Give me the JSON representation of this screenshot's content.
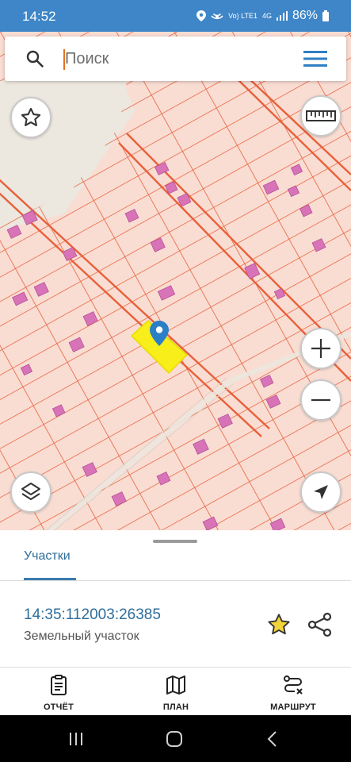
{
  "status_bar": {
    "time": "14:52",
    "network_top": "Vo) LTE1",
    "network_4g": "4G",
    "battery": "86%"
  },
  "search": {
    "placeholder": "Поиск"
  },
  "bottom_sheet": {
    "tab_label": "Участки",
    "parcel": {
      "cadastral_number": "14:35:112003:26385",
      "type": "Земельный участок"
    }
  },
  "bottom_nav": {
    "items": [
      {
        "label": "ОТЧЁТ",
        "icon": "report-icon"
      },
      {
        "label": "ПЛАН",
        "icon": "map-plan-icon"
      },
      {
        "label": "МАРШРУТ",
        "icon": "route-icon"
      }
    ]
  },
  "colors": {
    "status_bar": "#3e86c8",
    "map_background": "#f9ddd3",
    "parcel_lines": "#e8603a",
    "buildings": "#d873b8",
    "selected_parcel": "#f7ee1a",
    "marker": "#2a7fc6",
    "accent_text": "#2f6d9a",
    "favorite_star": "#f1d43a"
  }
}
